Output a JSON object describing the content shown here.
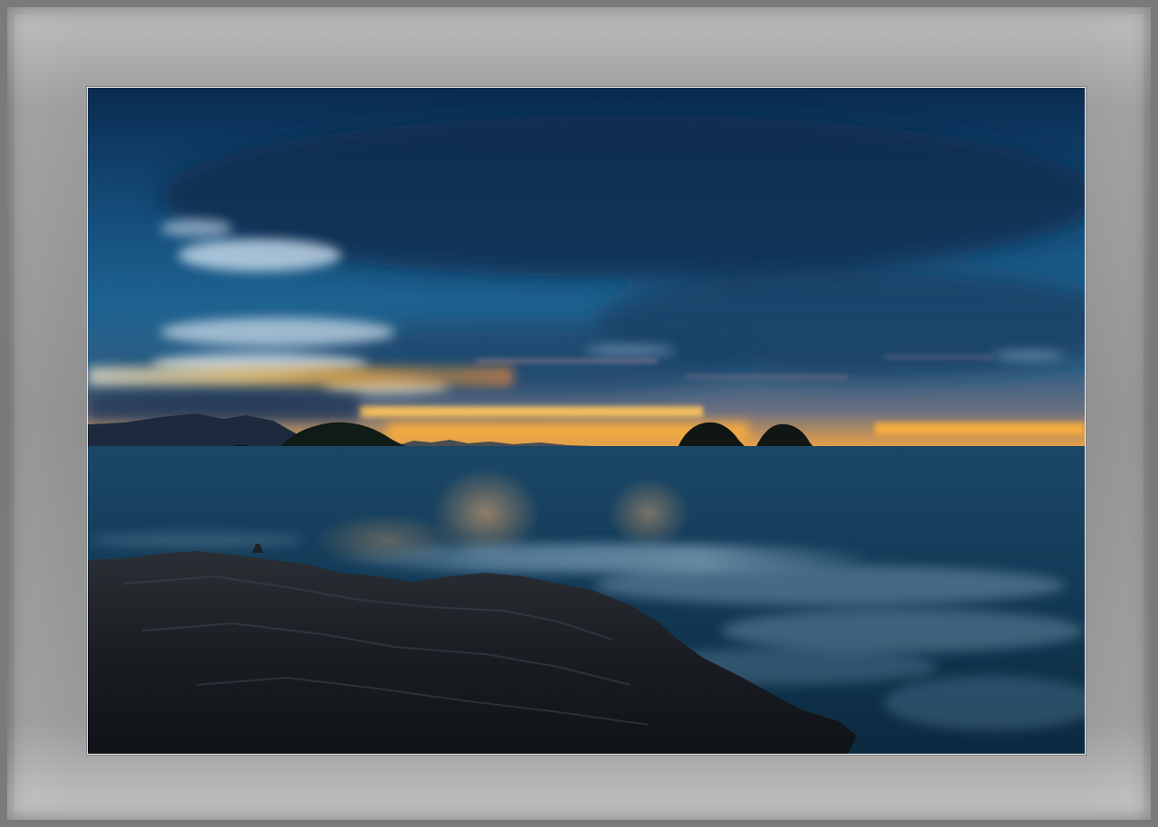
{
  "image": {
    "subject": "seascape-at-dusk",
    "palette": {
      "sky_deep": "#0b2f55",
      "sky_mid": "#1a5a86",
      "cloud_light": "#cfe2f2",
      "horizon_glow": "#ffb43a",
      "sea": "#123f5e",
      "rock": "#15191d",
      "frame": "#9c9c9c"
    }
  }
}
